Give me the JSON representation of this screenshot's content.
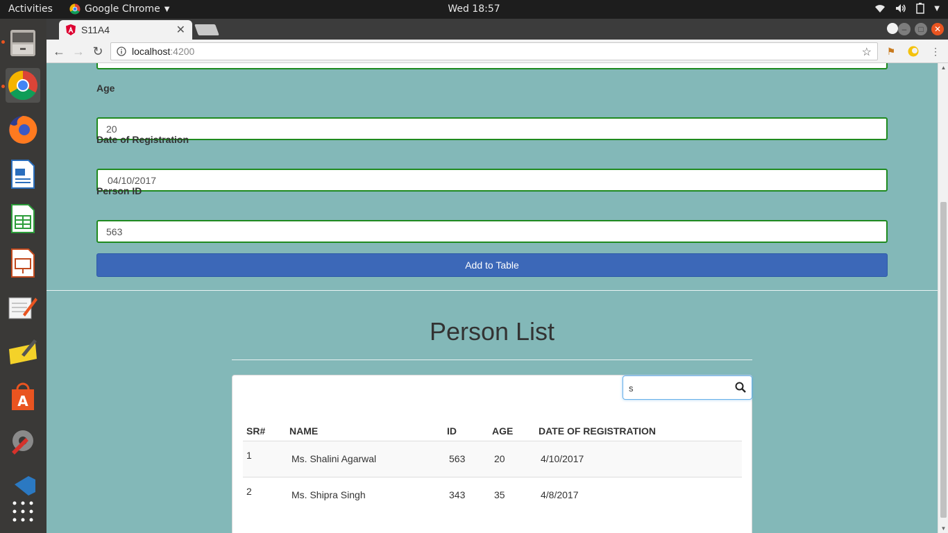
{
  "topbar": {
    "activities": "Activities",
    "app_name": "Google Chrome",
    "clock": "Wed 18:57"
  },
  "browser": {
    "tab_title": "S11A4",
    "url_host": "localhost",
    "url_port": ":4200"
  },
  "form": {
    "age_label": "Age",
    "age_value": "20",
    "date_label": "Date of Registration",
    "date_value": "04/10/2017",
    "person_id_label": "Person ID",
    "person_id_value": "563",
    "add_button": "Add to Table"
  },
  "list": {
    "title": "Person List",
    "search_value": "s",
    "columns": {
      "sr": "SR#",
      "name": "NAME",
      "id": "ID",
      "age": "AGE",
      "date": "DATE OF REGISTRATION"
    },
    "rows": [
      {
        "sr": "1",
        "name": "Ms. Shalini Agarwal",
        "id": "563",
        "age": "20",
        "date": "4/10/2017"
      },
      {
        "sr": "2",
        "name": "Ms. Shipra Singh",
        "id": "343",
        "age": "35",
        "date": "4/8/2017"
      }
    ]
  },
  "colors": {
    "page_background": "#83b8b8",
    "input_border": "#1f8a1f",
    "button_primary": "#3c68b8",
    "ubuntu_accent": "#e95420"
  }
}
